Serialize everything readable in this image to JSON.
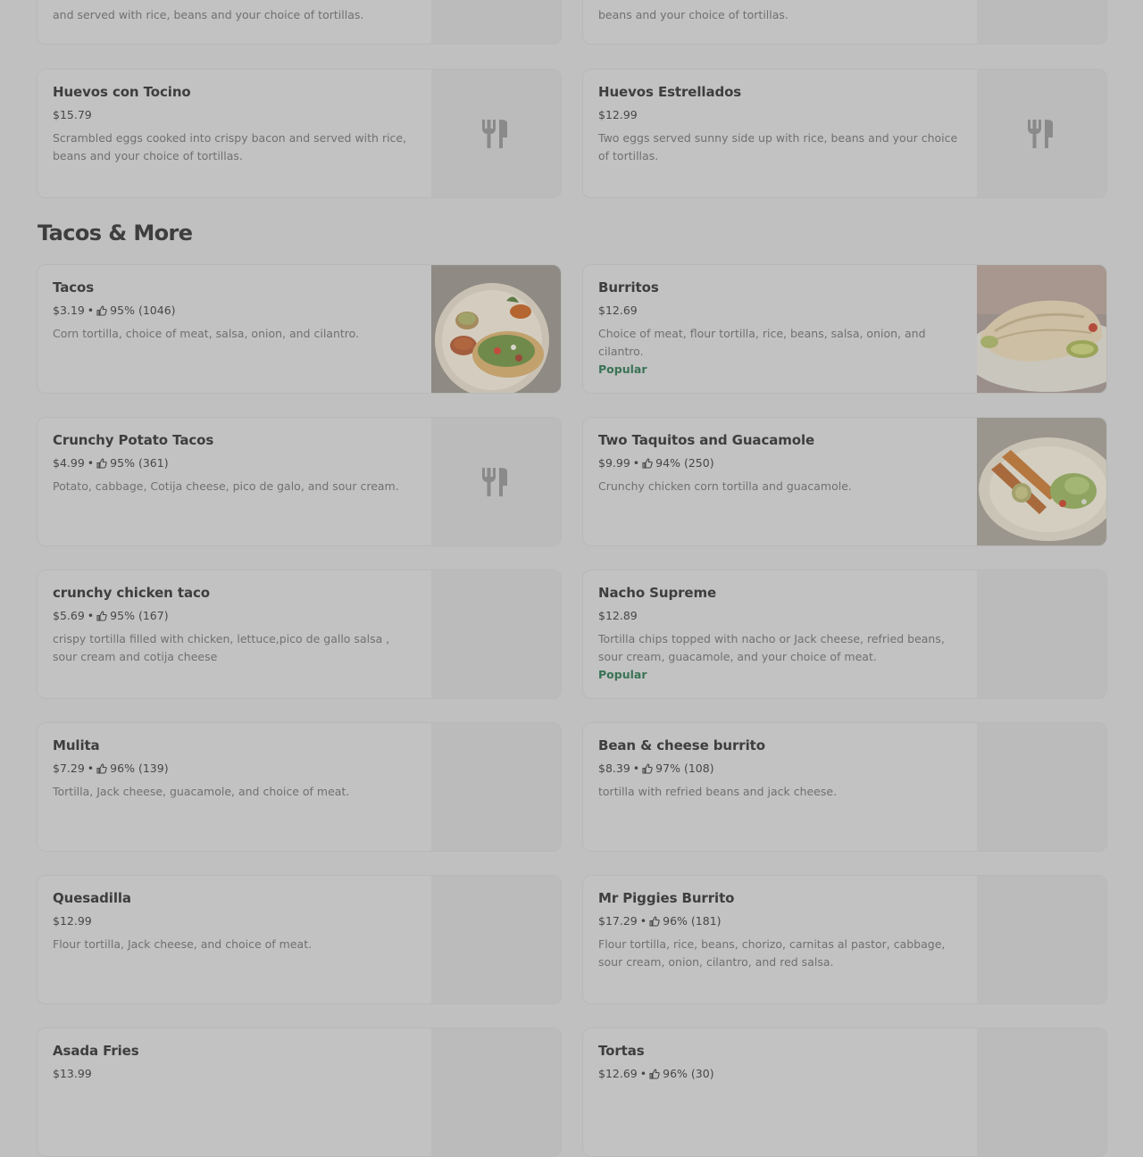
{
  "prev_section": {
    "partial_items": [
      {
        "desc": "and served with rice, beans and your choice of tortillas."
      },
      {
        "desc": "beans and your choice of tortillas."
      }
    ],
    "items": [
      {
        "name": "Huevos con Tocino",
        "price": "$15.79",
        "desc": "Scrambled eggs cooked into crispy bacon and served with rice, beans and your choice of tortillas.",
        "image_placeholder": "fork-knife-icon"
      },
      {
        "name": "Huevos Estrellados",
        "price": "$12.99",
        "desc": "Two eggs served sunny side up with rice, beans and your choice of tortillas.",
        "image_placeholder": "fork-knife-icon"
      }
    ]
  },
  "section": {
    "title": "Tacos & More",
    "items": [
      {
        "name": "Tacos",
        "price": "$3.19",
        "sep": "•",
        "rating": "95%",
        "count": "(1046)",
        "desc": "Corn tortilla, choice of meat, salsa, onion, and cilantro.",
        "image": "tacos-photo"
      },
      {
        "name": "Burritos",
        "price": "$12.69",
        "desc": "Choice of meat, flour tortilla, rice, beans, salsa, onion, and cilantro.",
        "badge": "Popular",
        "image": "burrito-photo"
      },
      {
        "name": "Crunchy Potato Tacos",
        "price": "$4.99",
        "sep": "•",
        "rating": "95%",
        "count": "(361)",
        "desc": "Potato, cabbage, Cotija cheese, pico de galo, and sour cream.",
        "image_placeholder": "fork-knife-icon"
      },
      {
        "name": "Two Taquitos and Guacamole",
        "price": "$9.99",
        "sep": "•",
        "rating": "94%",
        "count": "(250)",
        "desc": "Crunchy chicken corn tortilla and guacamole.",
        "image": "taquitos-photo"
      },
      {
        "name": "crunchy chicken taco",
        "price": "$5.69",
        "sep": "•",
        "rating": "95%",
        "count": "(167)",
        "desc": "crispy tortilla filled with chicken, lettuce,pico de gallo salsa , sour cream and cotija cheese"
      },
      {
        "name": "Nacho Supreme",
        "price": "$12.89",
        "desc": "Tortilla chips topped with nacho or Jack cheese, refried beans, sour cream, guacamole, and your choice of meat.",
        "badge": "Popular"
      },
      {
        "name": "Mulita",
        "price": "$7.29",
        "sep": "•",
        "rating": "96%",
        "count": "(139)",
        "desc": "Tortilla, Jack cheese, guacamole, and choice of meat."
      },
      {
        "name": "Bean & cheese burrito",
        "price": "$8.39",
        "sep": "•",
        "rating": "97%",
        "count": "(108)",
        "desc": "tortilla with refried beans and jack cheese."
      },
      {
        "name": "Quesadilla",
        "price": "$12.99",
        "desc": "Flour tortilla, Jack cheese, and choice of meat."
      },
      {
        "name": "Mr Piggies Burrito",
        "price": "$17.29",
        "sep": "•",
        "rating": "96%",
        "count": "(181)",
        "desc": "Flour tortilla, rice, beans, chorizo, carnitas al pastor, cabbage, sour cream, onion, cilantro, and red salsa."
      },
      {
        "name": "Asada Fries",
        "price": "$13.99"
      },
      {
        "name": "Tortas",
        "price": "$12.69",
        "sep": "•",
        "rating": "96%",
        "count": "(30)"
      }
    ]
  }
}
